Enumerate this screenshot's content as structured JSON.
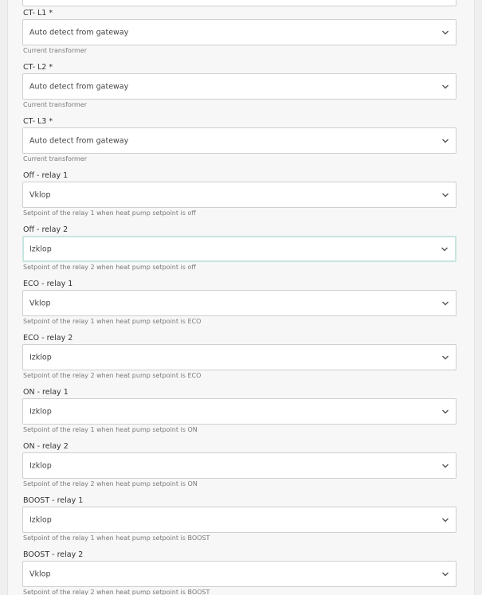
{
  "fields": [
    {
      "label": "CT- L1 *",
      "value": "Auto detect from gateway",
      "help": "Current transformer"
    },
    {
      "label": "CT- L2 *",
      "value": "Auto detect from gateway",
      "help": "Current transformer"
    },
    {
      "label": "CT- L3 *",
      "value": "Auto detect from gateway",
      "help": "Current transformer"
    },
    {
      "label": "Off - relay 1",
      "value": "Vklop",
      "help": "Setpoint of the relay 1 when heat pump setpoint is off"
    },
    {
      "label": "Off - relay 2",
      "value": "Izklop",
      "help": "Setpoint of the relay 2 when heat pump setpoint is off",
      "focused": true
    },
    {
      "label": "ECO - relay 1",
      "value": "Vklop",
      "help": "Setpoint of the relay 1 when heat pump setpoint is ECO"
    },
    {
      "label": "ECO - relay 2",
      "value": "Izklop",
      "help": "Setpoint of the relay 2 when heat pump setpoint is ECO"
    },
    {
      "label": "ON - relay 1",
      "value": "Izklop",
      "help": "Setpoint of the relay 1 when heat pump setpoint is ON"
    },
    {
      "label": "ON - relay 2",
      "value": "Izklop",
      "help": "Setpoint of the relay 2 when heat pump setpoint is ON"
    },
    {
      "label": "BOOST - relay 1",
      "value": "Izklop",
      "help": "Setpoint of the relay 1 when heat pump setpoint is BOOST"
    },
    {
      "label": "BOOST - relay 2",
      "value": "Vklop",
      "help": "Setpoint of the relay 2 when heat pump setpoint is BOOST"
    }
  ],
  "icons": {
    "dropdown": "chevron-down-icon"
  }
}
